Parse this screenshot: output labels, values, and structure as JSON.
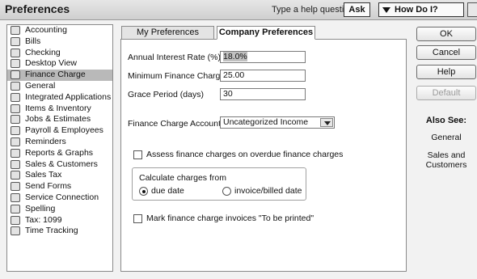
{
  "window": {
    "title": "Preferences",
    "help_prompt": "Type a help question",
    "ask_label": "Ask",
    "how_label": "How Do I?"
  },
  "categories": [
    {
      "label": "Accounting",
      "icon": "accounting-icon"
    },
    {
      "label": "Bills",
      "icon": "bills-icon"
    },
    {
      "label": "Checking",
      "icon": "checking-icon"
    },
    {
      "label": "Desktop View",
      "icon": "desktop-view-icon"
    },
    {
      "label": "Finance Charge",
      "icon": "finance-charge-icon",
      "selected": true
    },
    {
      "label": "General",
      "icon": "general-icon"
    },
    {
      "label": "Integrated Applications",
      "icon": "integrated-apps-icon"
    },
    {
      "label": "Items & Inventory",
      "icon": "items-inventory-icon"
    },
    {
      "label": "Jobs & Estimates",
      "icon": "jobs-estimates-icon"
    },
    {
      "label": "Payroll & Employees",
      "icon": "payroll-icon"
    },
    {
      "label": "Reminders",
      "icon": "reminders-icon"
    },
    {
      "label": "Reports & Graphs",
      "icon": "reports-graphs-icon"
    },
    {
      "label": "Sales & Customers",
      "icon": "sales-customers-icon"
    },
    {
      "label": "Sales Tax",
      "icon": "sales-tax-icon"
    },
    {
      "label": "Send Forms",
      "icon": "send-forms-icon"
    },
    {
      "label": "Service Connection",
      "icon": "service-connection-icon"
    },
    {
      "label": "Spelling",
      "icon": "spelling-icon"
    },
    {
      "label": "Tax: 1099",
      "icon": "tax-1099-icon"
    },
    {
      "label": "Time Tracking",
      "icon": "time-tracking-icon"
    }
  ],
  "tabs": {
    "my_prefs": "My Preferences",
    "company_prefs": "Company Preferences"
  },
  "form": {
    "interest_label": "Annual Interest Rate (%)",
    "interest_value": "18.0%",
    "min_charge_label": "Minimum Finance Charge",
    "min_charge_value": "25.00",
    "grace_label": "Grace Period (days)",
    "grace_value": "30",
    "account_label": "Finance Charge Account",
    "account_value": "Uncategorized Income",
    "assess_label": "Assess finance charges on overdue finance charges",
    "calc_label": "Calculate charges from",
    "radio_due": "due date",
    "radio_invoice": "invoice/billed date",
    "mark_label": "Mark finance charge invoices \"To be printed\""
  },
  "buttons": {
    "ok": "OK",
    "cancel": "Cancel",
    "help": "Help",
    "default": "Default"
  },
  "also_see": {
    "heading": "Also See:",
    "links": [
      "General",
      "Sales and Customers"
    ]
  }
}
